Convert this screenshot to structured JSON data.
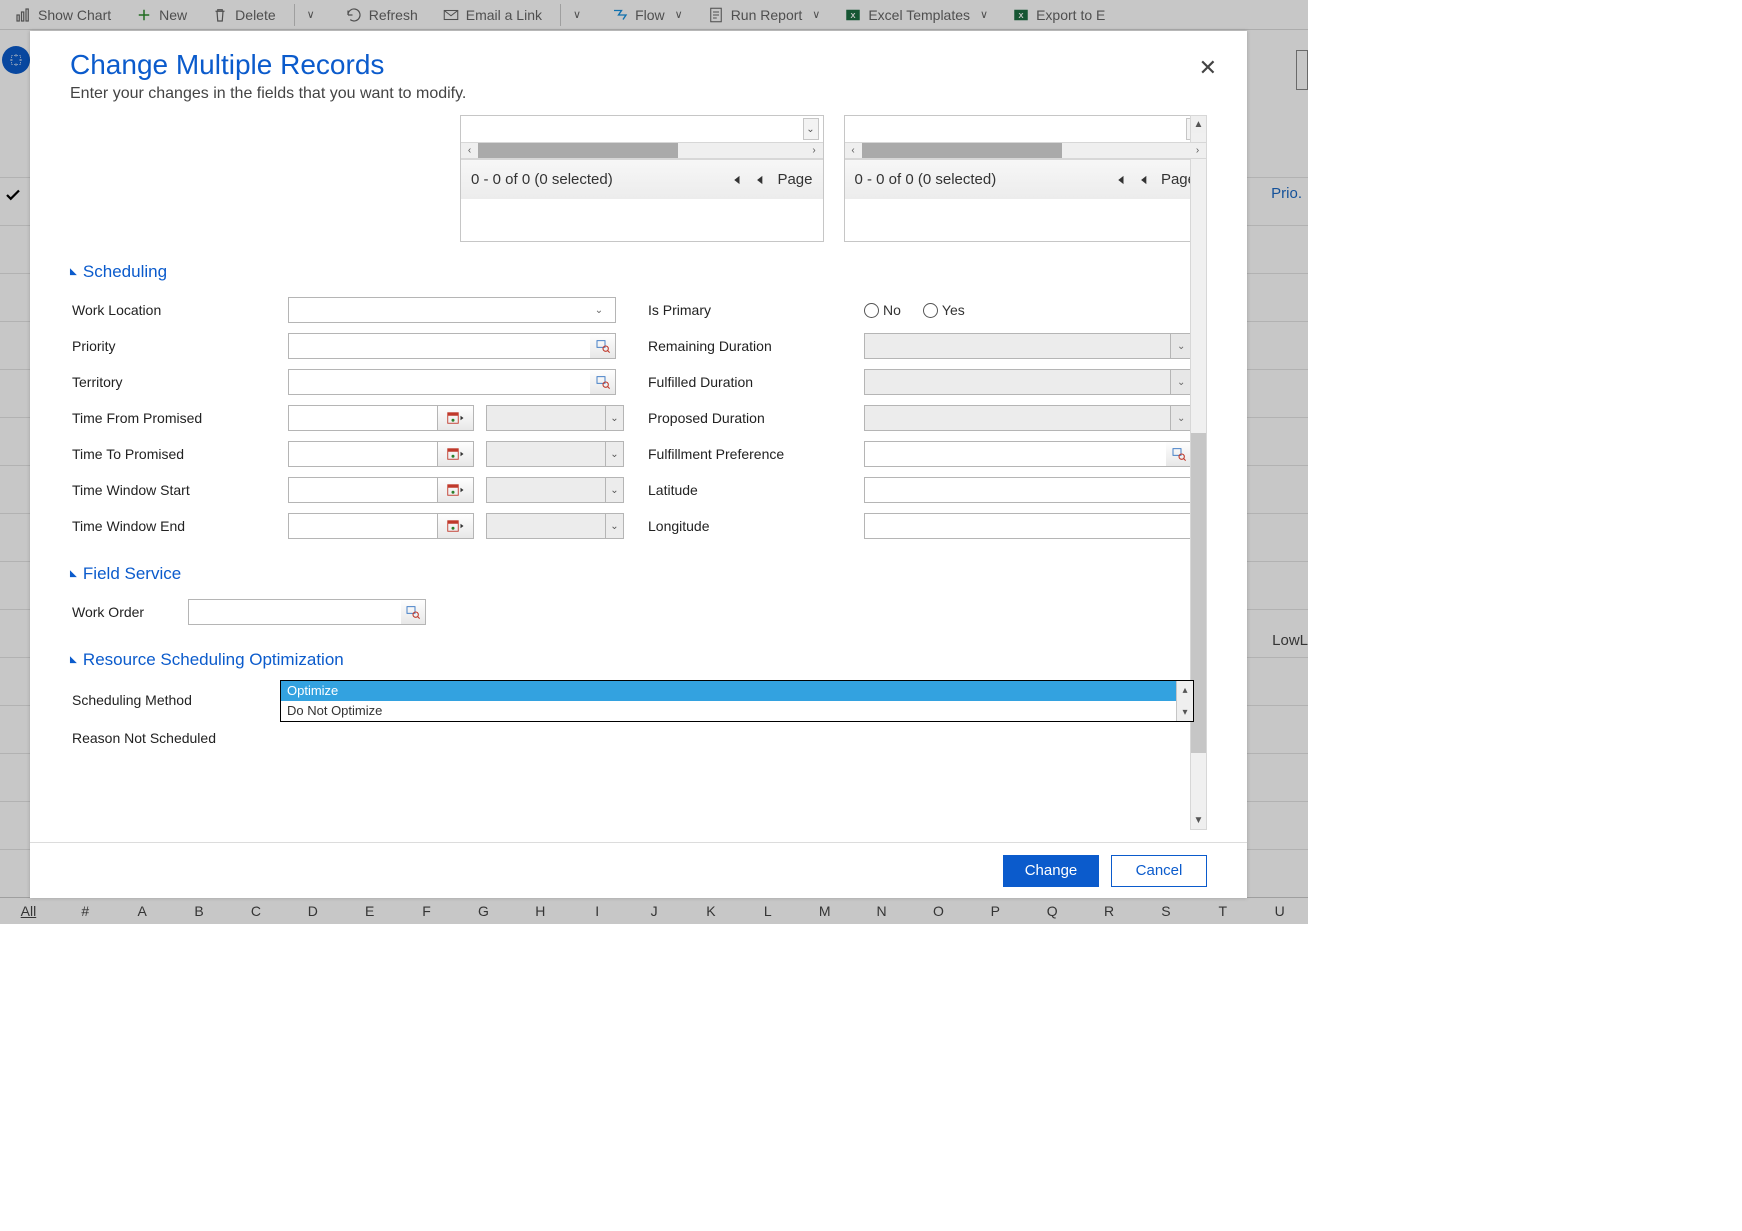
{
  "ribbon": {
    "show_chart": "Show Chart",
    "new": "New",
    "delete": "Delete",
    "refresh": "Refresh",
    "email_link": "Email a Link",
    "flow": "Flow",
    "run_report": "Run Report",
    "excel_templates": "Excel Templates",
    "export": "Export to E"
  },
  "dialog": {
    "title": "Change Multiple Records",
    "subtitle": "Enter your changes in the fields that you want to modify.",
    "close_glyph": "✕"
  },
  "listblock": {
    "status": "0 - 0 of 0 (0 selected)",
    "page": "Page"
  },
  "sections": {
    "scheduling": "Scheduling",
    "field_service": "Field Service",
    "rso": "Resource Scheduling Optimization"
  },
  "labels": {
    "work_location": "Work Location",
    "priority": "Priority",
    "territory": "Territory",
    "time_from_promised": "Time From Promised",
    "time_to_promised": "Time To Promised",
    "time_window_start": "Time Window Start",
    "time_window_end": "Time Window End",
    "is_primary": "Is Primary",
    "remaining_duration": "Remaining Duration",
    "fulfilled_duration": "Fulfilled Duration",
    "proposed_duration": "Proposed Duration",
    "fulfillment_preference": "Fulfillment Preference",
    "latitude": "Latitude",
    "longitude": "Longitude",
    "work_order": "Work Order",
    "scheduling_method": "Scheduling Method",
    "reason_not_scheduled": "Reason Not Scheduled"
  },
  "options": {
    "is_primary": {
      "no": "No",
      "yes": "Yes"
    },
    "scheduling_method": [
      "Optimize",
      "Do Not Optimize"
    ]
  },
  "buttons": {
    "change": "Change",
    "cancel": "Cancel"
  },
  "background": {
    "prio": "Prio.",
    "lowl": "LowL",
    "letters_all": "All",
    "letters": [
      "#",
      "A",
      "B",
      "C",
      "D",
      "E",
      "F",
      "G",
      "H",
      "I",
      "J",
      "K",
      "L",
      "M",
      "N",
      "O",
      "P",
      "Q",
      "R",
      "S",
      "T",
      "U"
    ]
  }
}
